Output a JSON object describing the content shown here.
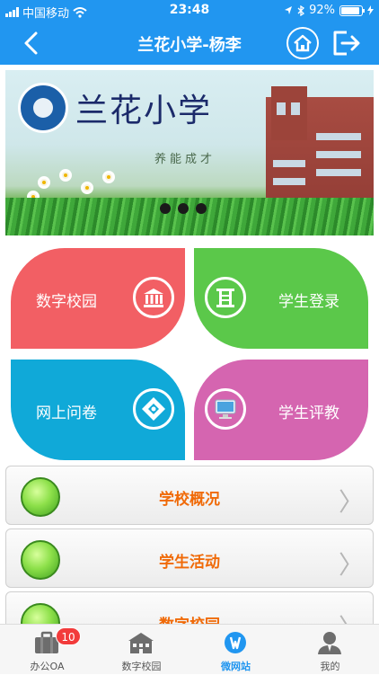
{
  "status": {
    "carrier": "中国移动",
    "time": "23:48",
    "battery": "92%"
  },
  "nav": {
    "title": "兰花小学-杨李"
  },
  "banner": {
    "school_name": "兰花小学",
    "motto": "养能成才",
    "slide_index": 1,
    "slide_count": 3
  },
  "tiles": [
    {
      "label": "数字校园",
      "icon": "building-icon",
      "color": "#f25f64"
    },
    {
      "label": "学生登录",
      "icon": "gate-icon",
      "color": "#5bc84a"
    },
    {
      "label": "网上问卷",
      "icon": "questionnaire-icon",
      "color": "#10a9d8"
    },
    {
      "label": "学生评教",
      "icon": "monitor-icon",
      "color": "#d565b0"
    }
  ],
  "menu": [
    {
      "label": "学校概况"
    },
    {
      "label": "学生活动"
    },
    {
      "label": "数字校园"
    }
  ],
  "tabbar": [
    {
      "label": "办公OA",
      "icon": "briefcase-icon",
      "badge": "10"
    },
    {
      "label": "数字校园",
      "icon": "school-icon"
    },
    {
      "label": "微网站",
      "icon": "microsite-icon",
      "active": true
    },
    {
      "label": "我的",
      "icon": "person-icon"
    }
  ],
  "colors": {
    "primary": "#2196f0",
    "accent": "#f06a08"
  }
}
